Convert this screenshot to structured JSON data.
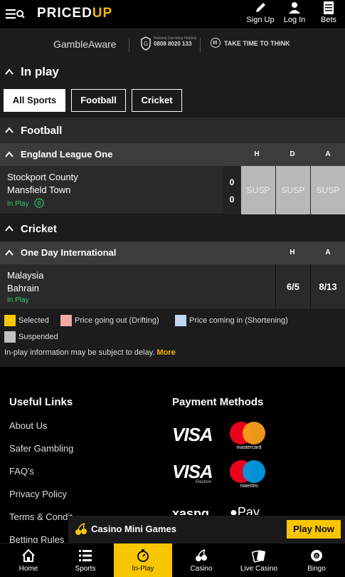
{
  "header": {
    "logo_text": "PRICED",
    "logo_accent": "UP",
    "sign_up": "Sign Up",
    "log_in": "Log In",
    "bets": "Bets"
  },
  "responsible": {
    "gamble_aware": "GambleAware",
    "helpline_small": "National Gambling Helpline",
    "helpline_number": "0808 8020 133",
    "take_time": "TAKE TIME TO THINK"
  },
  "inplay": {
    "title": "In play",
    "filters": [
      {
        "label": "All Sports",
        "active": true
      },
      {
        "label": "Football",
        "active": false
      },
      {
        "label": "Cricket",
        "active": false
      }
    ]
  },
  "football": {
    "title": "Football",
    "league": "England League One",
    "cols": [
      "H",
      "D",
      "A"
    ],
    "event": {
      "home": "Stockport County",
      "away": "Mansfield Town",
      "status": "In Play",
      "home_score": "0",
      "away_score": "0",
      "odds": [
        "SUSP",
        "SUSP",
        "SUSP"
      ]
    }
  },
  "cricket": {
    "title": "Cricket",
    "league": "One Day International",
    "cols": [
      "H",
      "A"
    ],
    "event": {
      "home": "Malaysia",
      "away": "Bahrain",
      "status": "In Play",
      "odds": [
        "6/5",
        "8/13"
      ]
    }
  },
  "legend": {
    "selected": "Selected",
    "drifting": "Price going out (Drifting)",
    "shortening": "Price coming in (Shortening)",
    "suspended": "Suspended",
    "delay": "In-play information may be subject to delay.",
    "more": "More",
    "colors": {
      "selected": "#f7c600",
      "drifting": "#f4a9a8",
      "shortening": "#bcd8f2",
      "suspended": "#c0c0c0"
    }
  },
  "footer": {
    "useful_links_title": "Useful Links",
    "links": [
      "About Us",
      "Safer Gambling",
      "FAQ's",
      "Privacy Policy",
      "Terms & Condit",
      "Betting Rules"
    ],
    "payment_title": "Payment Methods",
    "visa": "VISA",
    "visa_electron": "Electron",
    "mastercard": "mastercard",
    "maestro": "maestro",
    "apple_pay": "Pay"
  },
  "banner": {
    "text": "Casino Mini Games",
    "button": "Play Now"
  },
  "bottom_nav": [
    {
      "label": "Home",
      "icon": "home-icon"
    },
    {
      "label": "Sports",
      "icon": "list-icon"
    },
    {
      "label": "In-Play",
      "icon": "stopwatch-icon",
      "active": true
    },
    {
      "label": "Casino",
      "icon": "cherries-icon"
    },
    {
      "label": "Live Casino",
      "icon": "cards-icon"
    },
    {
      "label": "Bingo",
      "icon": "bingo-ball-icon"
    }
  ]
}
